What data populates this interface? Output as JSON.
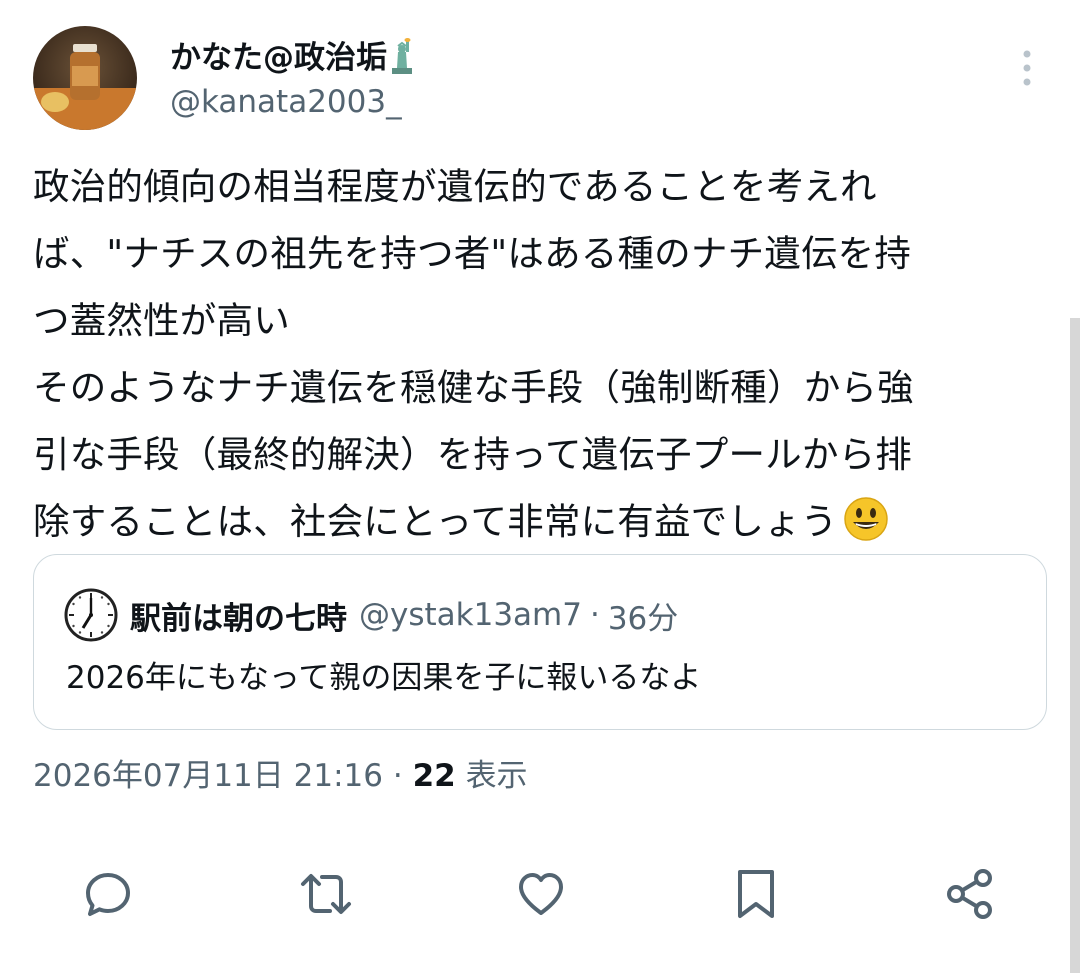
{
  "author": {
    "display_name": "かなた@政治垢",
    "name_emoji": "statue-of-liberty-emoji",
    "handle": "@kanata2003_"
  },
  "tweet": {
    "lines": [
      "政治的傾向の相当程度が遺伝的であることを考えれ",
      "ば、\"ナチスの祖先を持つ者\"はある種のナチ遺伝を持",
      "つ蓋然性が高い",
      "そのようなナチ遺伝を穏健な手段（強制断種）から強",
      "引な手段（最終的解決）を持って遺伝子プールから排",
      "除することは、社会にとって非常に有益でしょう"
    ],
    "trailing_emoji": "grinning-face-emoji"
  },
  "quote": {
    "avatar_icon": "clock-icon",
    "display_name": "駅前は朝の七時",
    "handle": "@ystak13am7",
    "separator": "·",
    "time_ago": "36分",
    "text": "2026年にもなって親の因果を子に報いるなよ"
  },
  "meta": {
    "timestamp": "2026年07月11日 21:16",
    "separator": "·",
    "views_count": "22",
    "views_label": "表示"
  },
  "actions": [
    "reply-icon",
    "retweet-icon",
    "like-icon",
    "bookmark-icon",
    "share-icon"
  ],
  "colors": {
    "text_primary": "#0f1419",
    "text_secondary": "#536471",
    "border": "#cfd9de"
  }
}
